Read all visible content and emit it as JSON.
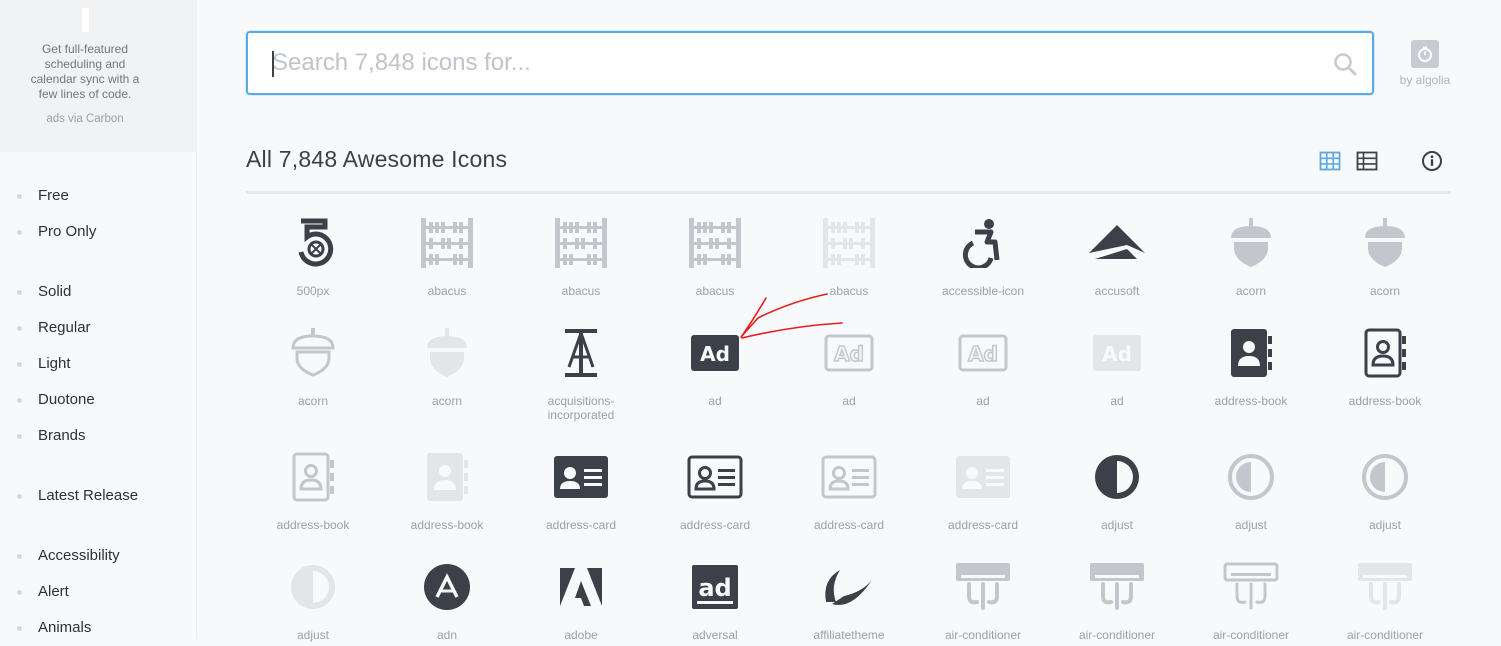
{
  "ad": {
    "text": "Get full-featured scheduling and calendar sync with a few lines of code.",
    "via": "ads via Carbon"
  },
  "nav": {
    "group1": [
      "Free",
      "Pro Only"
    ],
    "group2": [
      "Solid",
      "Regular",
      "Light",
      "Duotone",
      "Brands"
    ],
    "group3": [
      "Latest Release"
    ],
    "group4": [
      "Accessibility",
      "Alert",
      "Animals"
    ]
  },
  "search": {
    "placeholder": "Search 7,848 icons for...",
    "value": ""
  },
  "algolia": {
    "label": "by algolia"
  },
  "heading": "All 7,848 Awesome Icons",
  "colors": {
    "accent": "#5aa9e6",
    "dark_icon": "#3c4049",
    "faded_icon": "#c3c7cd",
    "faint_icon": "#e3e5e8",
    "annotation": "#e02020"
  },
  "icons": [
    {
      "name": "500px",
      "icon": "500px-icon",
      "tone": "dark"
    },
    {
      "name": "abacus",
      "icon": "abacus-icon",
      "tone": "faded"
    },
    {
      "name": "abacus",
      "icon": "abacus-icon",
      "tone": "faded"
    },
    {
      "name": "abacus",
      "icon": "abacus-icon",
      "tone": "faded"
    },
    {
      "name": "abacus",
      "icon": "abacus-icon",
      "tone": "faint"
    },
    {
      "name": "accessible-icon",
      "icon": "accessible-icon",
      "tone": "dark"
    },
    {
      "name": "accusoft",
      "icon": "accusoft-icon",
      "tone": "dark"
    },
    {
      "name": "acorn",
      "icon": "acorn-icon",
      "tone": "faded"
    },
    {
      "name": "acorn",
      "icon": "acorn-icon",
      "tone": "faded"
    },
    {
      "name": "acorn",
      "icon": "acorn-outline-icon",
      "tone": "faded"
    },
    {
      "name": "acorn",
      "icon": "acorn-icon",
      "tone": "faint"
    },
    {
      "name": "acquisitions-incorporated",
      "icon": "acquisitions-incorporated-icon",
      "tone": "dark"
    },
    {
      "name": "ad",
      "icon": "ad-icon",
      "tone": "dark"
    },
    {
      "name": "ad",
      "icon": "ad-outline-icon",
      "tone": "faded"
    },
    {
      "name": "ad",
      "icon": "ad-outline-icon",
      "tone": "faded"
    },
    {
      "name": "ad",
      "icon": "ad-icon",
      "tone": "faint"
    },
    {
      "name": "address-book",
      "icon": "address-book-icon",
      "tone": "dark"
    },
    {
      "name": "address-book",
      "icon": "address-book-outline-icon",
      "tone": "dark"
    },
    {
      "name": "address-book",
      "icon": "address-book-outline-icon",
      "tone": "faded"
    },
    {
      "name": "address-book",
      "icon": "address-book-icon",
      "tone": "faint"
    },
    {
      "name": "address-card",
      "icon": "address-card-icon",
      "tone": "dark"
    },
    {
      "name": "address-card",
      "icon": "address-card-outline-icon",
      "tone": "dark"
    },
    {
      "name": "address-card",
      "icon": "address-card-outline-icon",
      "tone": "faded"
    },
    {
      "name": "address-card",
      "icon": "address-card-icon",
      "tone": "faint"
    },
    {
      "name": "adjust",
      "icon": "adjust-icon",
      "tone": "dark"
    },
    {
      "name": "adjust",
      "icon": "adjust-outline-icon",
      "tone": "faded"
    },
    {
      "name": "adjust",
      "icon": "adjust-outline-icon",
      "tone": "faded"
    },
    {
      "name": "adjust",
      "icon": "adjust-icon",
      "tone": "faint"
    },
    {
      "name": "adn",
      "icon": "adn-icon",
      "tone": "dark"
    },
    {
      "name": "adobe",
      "icon": "adobe-icon",
      "tone": "dark"
    },
    {
      "name": "adversal",
      "icon": "adversal-icon",
      "tone": "dark"
    },
    {
      "name": "affiliatetheme",
      "icon": "affiliatetheme-icon",
      "tone": "dark"
    },
    {
      "name": "air-conditioner",
      "icon": "air-conditioner-icon",
      "tone": "faded"
    },
    {
      "name": "air-conditioner",
      "icon": "air-conditioner-icon",
      "tone": "faded"
    },
    {
      "name": "air-conditioner",
      "icon": "air-conditioner-outline-icon",
      "tone": "faded"
    },
    {
      "name": "air-conditioner",
      "icon": "air-conditioner-icon",
      "tone": "faint"
    }
  ]
}
